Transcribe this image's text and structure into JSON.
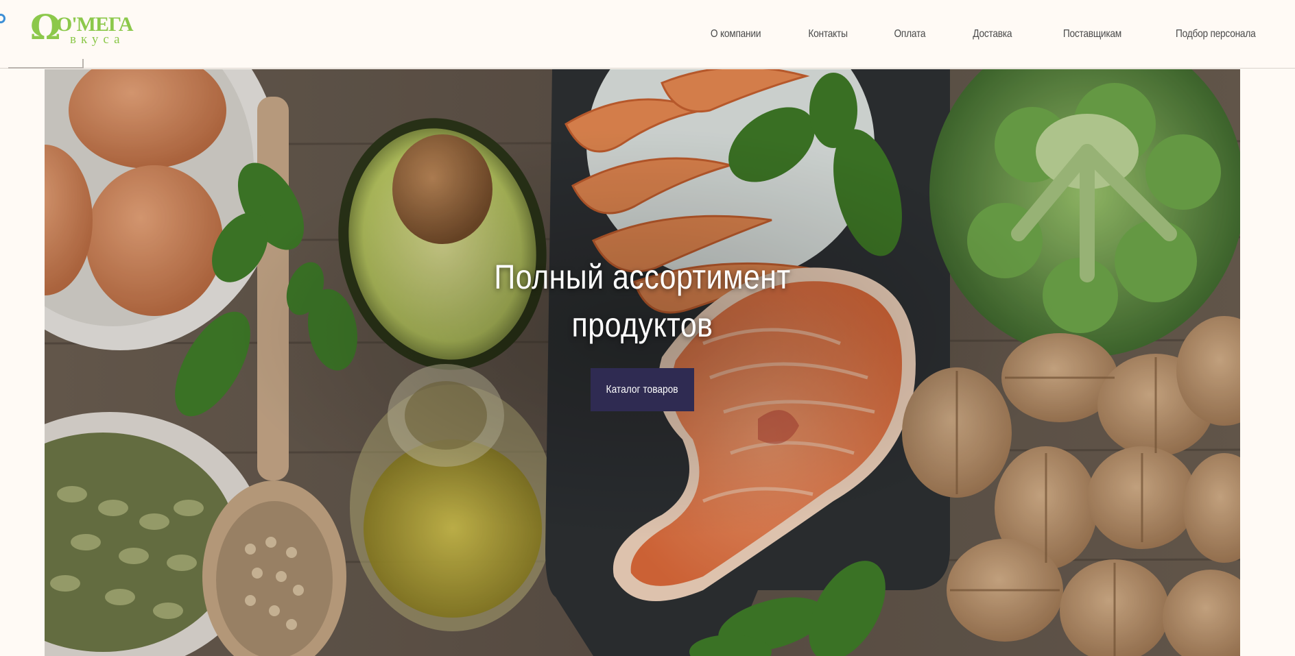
{
  "brand": {
    "name": "O'МЕГА",
    "subtitle": "вкуса",
    "symbol": "Ω",
    "color": "#8cc84b"
  },
  "nav": {
    "items": [
      {
        "label": "О компании"
      },
      {
        "label": "Контакты"
      },
      {
        "label": "Оплата"
      },
      {
        "label": "Доставка"
      },
      {
        "label": "Поставщикам"
      },
      {
        "label": "Подбор персонала"
      }
    ]
  },
  "hero": {
    "title_line1": "Полный ассортимент",
    "title_line2": "продуктов",
    "button_label": "Каталог товаров",
    "button_color": "#2f2b52",
    "image": "healthy-food-flatlay (eggs, avocado, shrimp, basil, broccoli, salmon steak, walnuts, pumpkin seeds, olive oil, buckwheat)"
  }
}
